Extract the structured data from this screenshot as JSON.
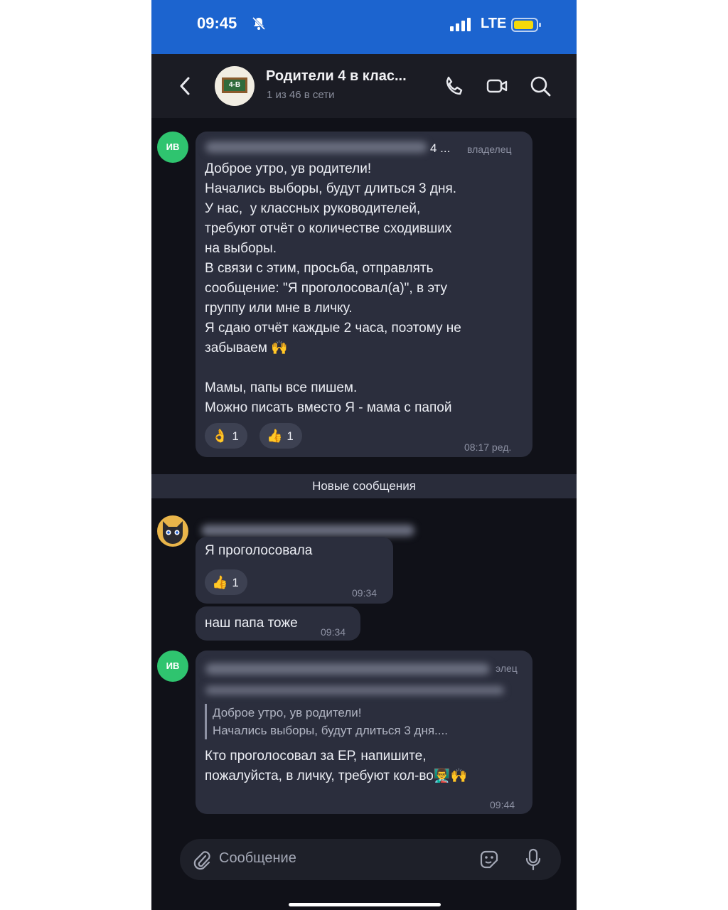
{
  "status": {
    "time": "09:45",
    "network": "LTE"
  },
  "header": {
    "title": "Родители 4 в клас...",
    "subtitle": "1 из 46 в сети",
    "avatar_text": "4-В"
  },
  "messages": [
    {
      "avatar": "ИВ",
      "name_suffix": "4 ...",
      "role": "владелец",
      "text": "Доброе утро, ув родители!\nНачались выборы, будут длиться 3 дня.\nУ нас,  у классных руководителей,\nтребуют отчёт о количестве сходивших\nна выборы.\nВ связи с этим, просьба, отправлять\nсообщение: \"Я проголосовал(а)\", в эту\nгруппу или мне в личку.\nЯ сдаю отчёт каждые 2 часа, поэтому не\nзабываем 🙌\n\nМамы, папы все пишем.\nМожно писать вместо Я - мама с папой",
      "reactions": [
        {
          "emoji": "👌",
          "count": "1"
        },
        {
          "emoji": "👍",
          "count": "1"
        }
      ],
      "time": "08:17 ред."
    },
    {
      "text": "Я проголосовала",
      "reactions": [
        {
          "emoji": "👍",
          "count": "1"
        }
      ],
      "time": "09:34"
    },
    {
      "text": "наш папа тоже",
      "time": "09:34"
    },
    {
      "avatar": "ИВ",
      "role": "элец",
      "quote_line1": "Доброе утро, ув родители!",
      "quote_line2": "Начались выборы, будут длиться 3 дня....",
      "text": "Кто проголосовал за ЕР, напишите,\nпожалуйста, в личку, требуют кол-во👨‍🏫🙌",
      "time": "09:44"
    }
  ],
  "divider": "Новые сообщения",
  "composer": {
    "placeholder": "Сообщение"
  },
  "colors": {
    "status_bar": "#1c64cf",
    "bubble": "#2b2e3d",
    "background": "#101118",
    "avatar_green": "#2fc46f"
  },
  "icons": [
    "bell-muted-icon",
    "signal-icon",
    "battery-icon",
    "back-arrow-icon",
    "phone-icon",
    "video-icon",
    "search-icon",
    "attach-icon",
    "sticker-icon",
    "mic-icon"
  ]
}
